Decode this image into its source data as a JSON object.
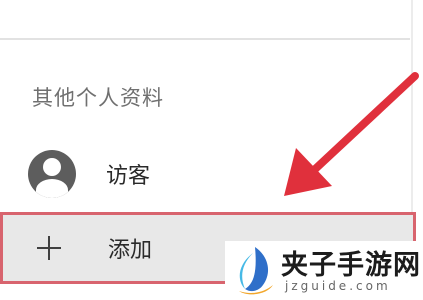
{
  "section": {
    "title": "其他个人资料"
  },
  "profiles": [
    {
      "label": "访客",
      "icon": "user-avatar-icon"
    }
  ],
  "add_profile": {
    "label": "添加",
    "icon": "plus-icon"
  },
  "annotation": {
    "arrow_color": "#e0303c",
    "highlight_color": "#d8646e"
  },
  "watermark": {
    "title": "夹子手游网",
    "url": "jzguide.com"
  }
}
